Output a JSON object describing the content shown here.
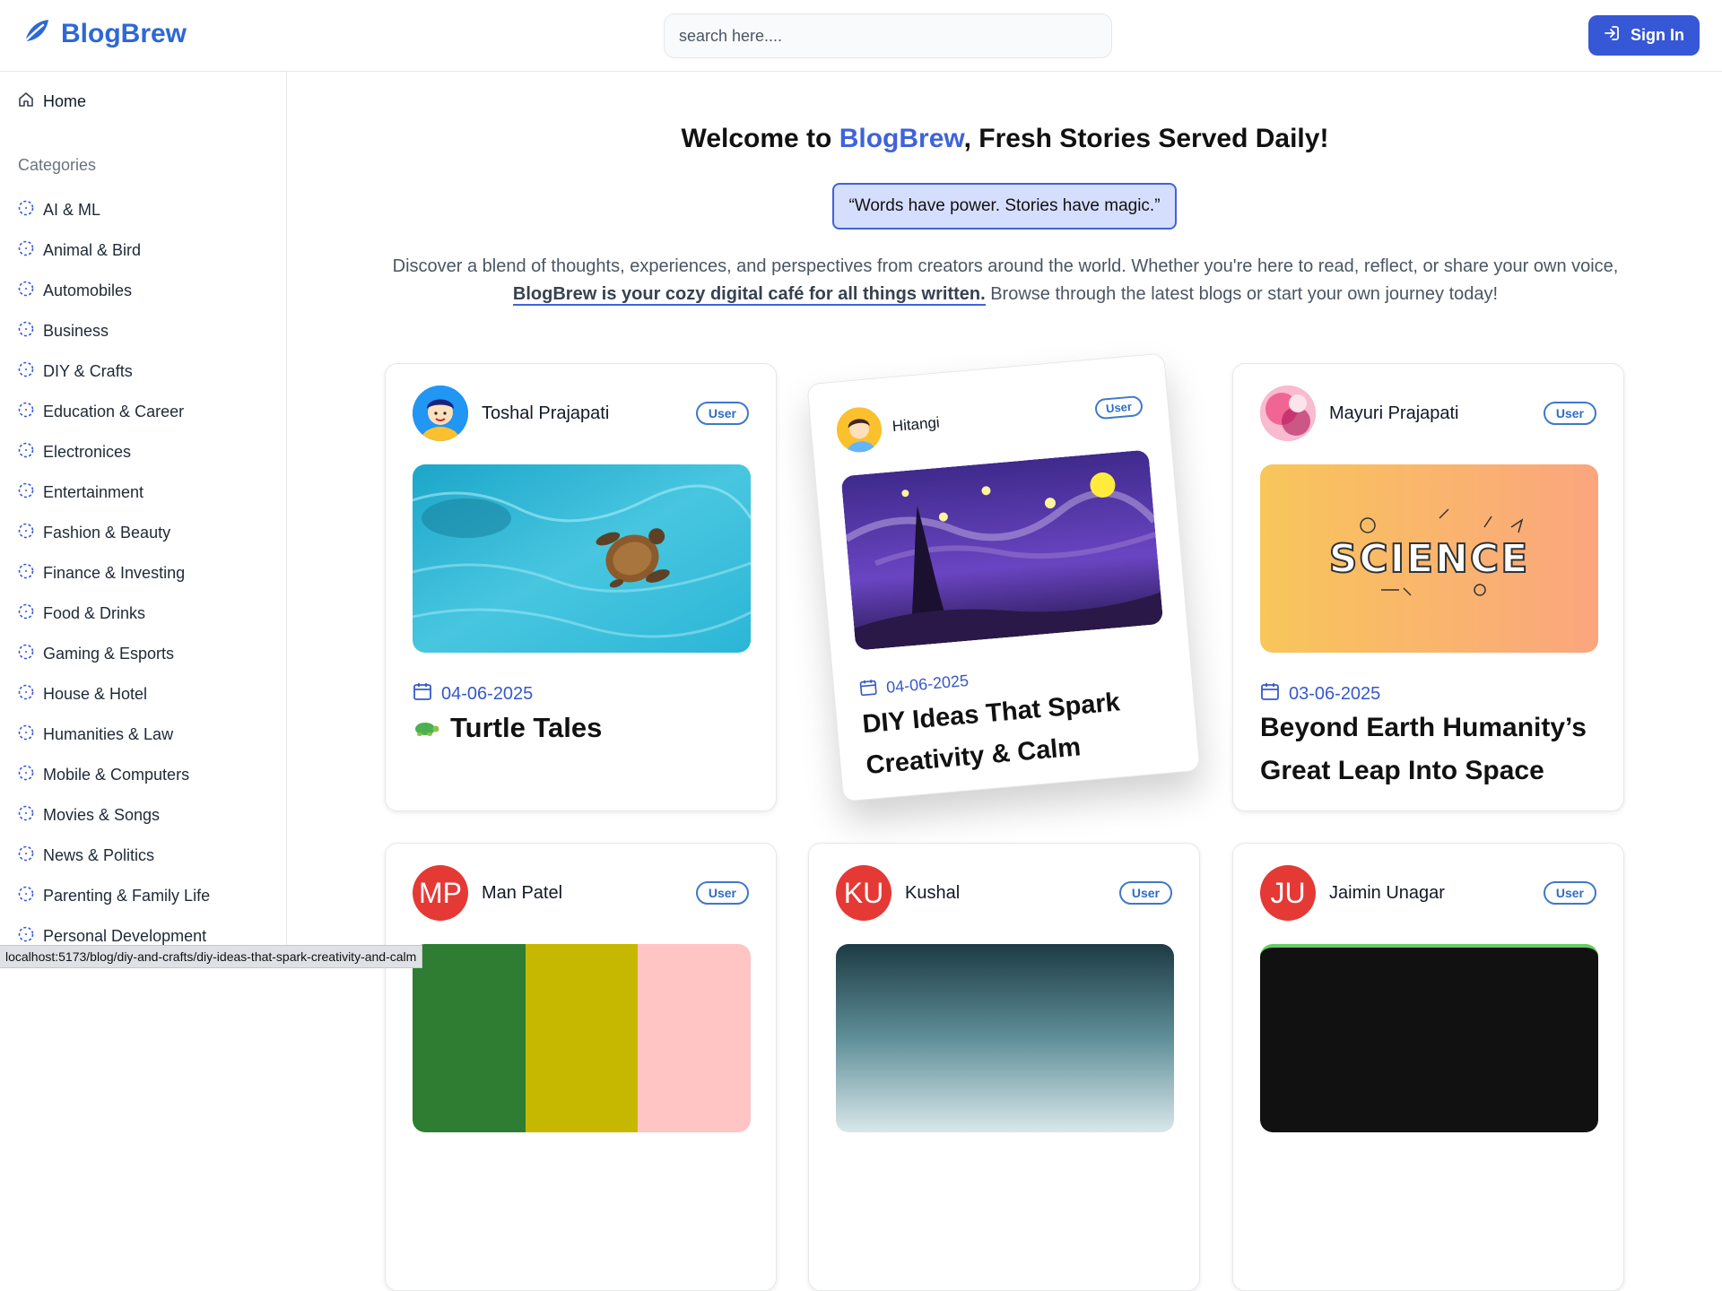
{
  "header": {
    "brand": "BlogBrew",
    "search_placeholder": "search here....",
    "signin_label": "Sign In"
  },
  "sidebar": {
    "home_label": "Home",
    "categories_title": "Categories",
    "categories": [
      "AI & ML",
      "Animal & Bird",
      "Automobiles",
      "Business",
      "DIY & Crafts",
      "Education & Career",
      "Electronices",
      "Entertainment",
      "Fashion & Beauty",
      "Finance & Investing",
      "Food & Drinks",
      "Gaming & Esports",
      "House & Hotel",
      "Humanities & Law",
      "Mobile & Computers",
      "Movies & Songs",
      "News & Politics",
      "Parenting & Family Life",
      "Personal Development"
    ]
  },
  "hero": {
    "welcome_prefix": "Welcome to ",
    "welcome_brand": "BlogBrew",
    "welcome_suffix": ", Fresh Stories Served Daily!",
    "quote": "“Words have power. Stories have magic.”",
    "intro_part1": "Discover a blend of thoughts, experiences, and perspectives from creators around the world. Whether you're here to read, reflect, or share your own voice, ",
    "intro_bold": "BlogBrew is your cozy digital café for all things written.",
    "intro_part2": " Browse through the latest blogs or start your own journey today!"
  },
  "posts": [
    {
      "author": "Toshal Prajapati",
      "badge": "User",
      "date": "04-06-2025",
      "title": "Turtle Tales"
    },
    {
      "author": "Hitangi",
      "badge": "User",
      "date": "04-06-2025",
      "title": "DIY Ideas That Spark Creativity & Calm"
    },
    {
      "author": "Mayuri Prajapati",
      "badge": "User",
      "date": "03-06-2025",
      "title": "Beyond Earth Humanity’s Great Leap Into Space"
    },
    {
      "author": "Man Patel",
      "badge": "User",
      "initials": "MP"
    },
    {
      "author": "Kushal",
      "badge": "User",
      "initials": "KU"
    },
    {
      "author": "Jaimin Unagar",
      "badge": "User",
      "initials": "JU"
    }
  ],
  "thumb_text": {
    "science": "SCIENCE"
  },
  "status_url": "localhost:5173/blog/diy-and-crafts/diy-ideas-that-spark-creativity-and-calm",
  "colors": {
    "brand": "#2d68d6",
    "accent": "#3f63d8",
    "button": "#3657d6",
    "initials_bg": "#e53935"
  }
}
